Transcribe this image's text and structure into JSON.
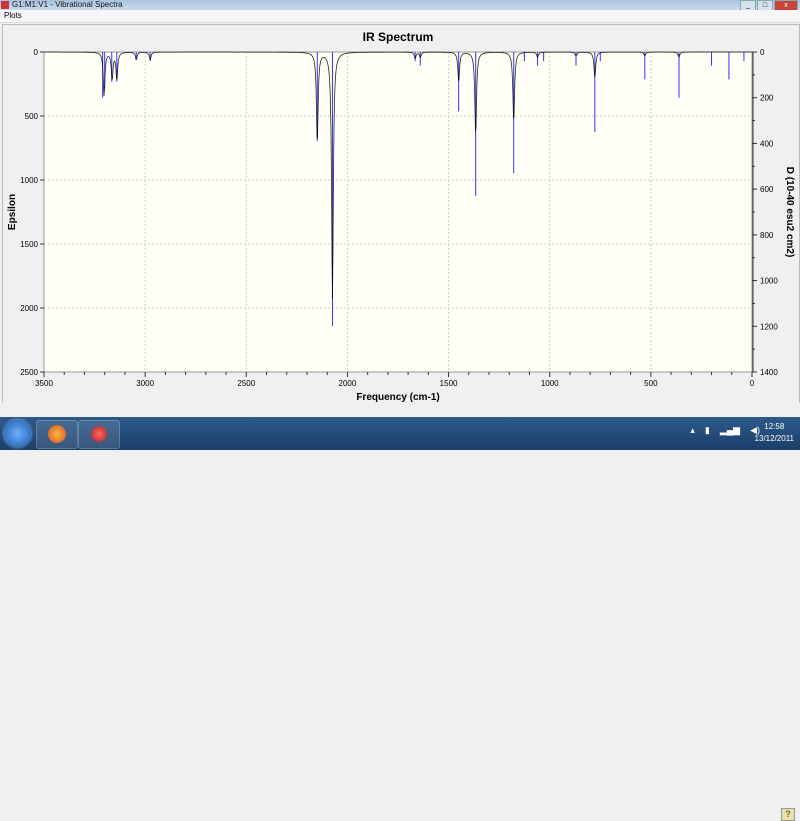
{
  "window": {
    "title": "G1:M1:V1 - Vibrational Spectra",
    "menu": [
      "Plots"
    ]
  },
  "chart_data": {
    "type": "line",
    "title": "IR Spectrum",
    "xlabel": "Frequency (cm-1)",
    "ylabel_left": "Epsilon",
    "ylabel_right": "D (10-40 esu2 cm2)",
    "xlim": [
      3500,
      0
    ],
    "ylim_left": [
      0,
      2500
    ],
    "ylim_right": [
      0,
      1400
    ],
    "x_ticks": [
      "3500",
      "3000",
      "2500",
      "2000",
      "1500",
      "1000",
      "500",
      "0"
    ],
    "y_left_ticks": [
      "0",
      "500",
      "1000",
      "1500",
      "2000",
      "2500"
    ],
    "y_right_ticks": [
      "0",
      "200",
      "400",
      "600",
      "800",
      "1000",
      "1200",
      "1400"
    ],
    "grid": true,
    "inverted_y": true,
    "series": [
      {
        "kind": "spectrum",
        "color": "#000000",
        "peaks": [
          {
            "freq": 3203,
            "epsilon": 340
          },
          {
            "freq": 3163,
            "epsilon": 210
          },
          {
            "freq": 3140,
            "epsilon": 210
          },
          {
            "freq": 3044,
            "epsilon": 60
          },
          {
            "freq": 2975,
            "epsilon": 60
          },
          {
            "freq": 2149,
            "epsilon": 700
          },
          {
            "freq": 2074,
            "epsilon": 1930
          },
          {
            "freq": 1665,
            "epsilon": 50
          },
          {
            "freq": 1640,
            "epsilon": 40
          },
          {
            "freq": 1450,
            "epsilon": 230
          },
          {
            "freq": 1366,
            "epsilon": 640
          },
          {
            "freq": 1178,
            "epsilon": 540
          },
          {
            "freq": 1060,
            "epsilon": 40
          },
          {
            "freq": 870,
            "epsilon": 30
          },
          {
            "freq": 777,
            "epsilon": 200
          },
          {
            "freq": 530,
            "epsilon": 30
          },
          {
            "freq": 361,
            "epsilon": 40
          }
        ]
      },
      {
        "kind": "sticks",
        "color": "#3333ff",
        "sticks": [
          {
            "freq": 3210,
            "D": 200
          },
          {
            "freq": 3200,
            "D": 160
          },
          {
            "freq": 3165,
            "D": 130
          },
          {
            "freq": 3140,
            "D": 130
          },
          {
            "freq": 3044,
            "D": 30
          },
          {
            "freq": 2975,
            "D": 40
          },
          {
            "freq": 2149,
            "D": 390
          },
          {
            "freq": 2074,
            "D": 1200
          },
          {
            "freq": 1665,
            "D": 40
          },
          {
            "freq": 1640,
            "D": 60
          },
          {
            "freq": 1450,
            "D": 260
          },
          {
            "freq": 1366,
            "D": 630
          },
          {
            "freq": 1178,
            "D": 530
          },
          {
            "freq": 1125,
            "D": 40
          },
          {
            "freq": 1060,
            "D": 60
          },
          {
            "freq": 1030,
            "D": 40
          },
          {
            "freq": 870,
            "D": 60
          },
          {
            "freq": 777,
            "D": 350
          },
          {
            "freq": 750,
            "D": 40
          },
          {
            "freq": 530,
            "D": 120
          },
          {
            "freq": 361,
            "D": 200
          },
          {
            "freq": 200,
            "D": 60
          },
          {
            "freq": 114,
            "D": 120
          },
          {
            "freq": 40,
            "D": 40
          }
        ]
      }
    ]
  },
  "taskbar": {
    "time": "12:58",
    "date": "13/12/2011",
    "help": "?"
  }
}
